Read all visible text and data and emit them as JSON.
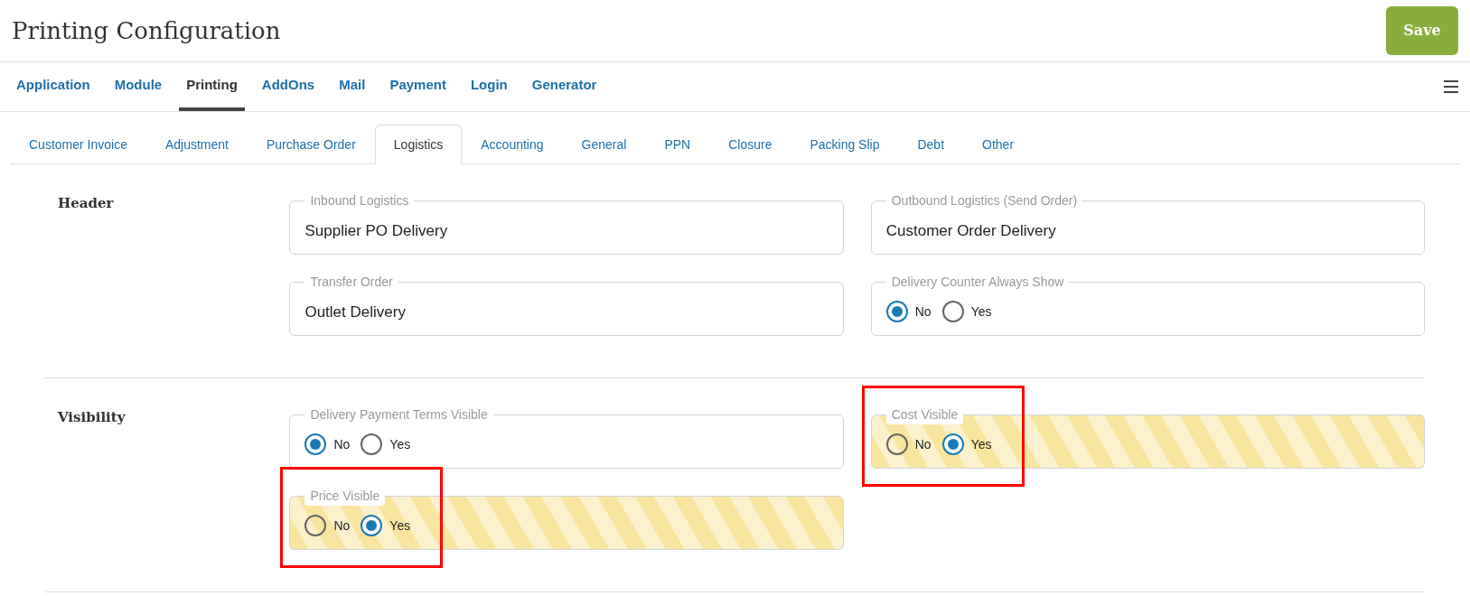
{
  "page": {
    "title": "Printing Configuration",
    "save_button": "Save"
  },
  "main_tabs": [
    {
      "label": "Application",
      "selected": false
    },
    {
      "label": "Module",
      "selected": false
    },
    {
      "label": "Printing",
      "selected": true
    },
    {
      "label": "AddOns",
      "selected": false
    },
    {
      "label": "Mail",
      "selected": false
    },
    {
      "label": "Payment",
      "selected": false
    },
    {
      "label": "Login",
      "selected": false
    },
    {
      "label": "Generator",
      "selected": false
    }
  ],
  "sub_tabs": [
    {
      "label": "Customer Invoice",
      "selected": false
    },
    {
      "label": "Adjustment",
      "selected": false
    },
    {
      "label": "Purchase Order",
      "selected": false
    },
    {
      "label": "Logistics",
      "selected": true
    },
    {
      "label": "Accounting",
      "selected": false
    },
    {
      "label": "General",
      "selected": false
    },
    {
      "label": "PPN",
      "selected": false
    },
    {
      "label": "Closure",
      "selected": false
    },
    {
      "label": "Packing Slip",
      "selected": false
    },
    {
      "label": "Debt",
      "selected": false
    },
    {
      "label": "Other",
      "selected": false
    }
  ],
  "sections": [
    {
      "title": "Header",
      "fields": [
        {
          "kind": "text",
          "label": "Inbound Logistics",
          "value": "Supplier PO Delivery",
          "highlighted": false,
          "annotated": false
        },
        {
          "kind": "text",
          "label": "Outbound Logistics (Send Order)",
          "value": "Customer Order Delivery",
          "highlighted": false,
          "annotated": false
        },
        {
          "kind": "text",
          "label": "Transfer Order",
          "value": "Outlet Delivery",
          "highlighted": false,
          "annotated": false
        },
        {
          "kind": "radio",
          "label": "Delivery Counter Always Show",
          "options": [
            {
              "label": "No",
              "selected": true
            },
            {
              "label": "Yes",
              "selected": false
            }
          ],
          "highlighted": false,
          "annotated": false
        }
      ]
    },
    {
      "title": "Visibility",
      "fields": [
        {
          "kind": "radio",
          "label": "Delivery Payment Terms Visible",
          "options": [
            {
              "label": "No",
              "selected": true
            },
            {
              "label": "Yes",
              "selected": false
            }
          ],
          "highlighted": false,
          "annotated": false
        },
        {
          "kind": "radio",
          "label": "Cost Visible",
          "options": [
            {
              "label": "No",
              "selected": false
            },
            {
              "label": "Yes",
              "selected": true
            }
          ],
          "highlighted": true,
          "annotated": true
        },
        {
          "kind": "radio",
          "label": "Price Visible",
          "options": [
            {
              "label": "No",
              "selected": false
            },
            {
              "label": "Yes",
              "selected": true
            }
          ],
          "highlighted": true,
          "annotated": true
        }
      ]
    }
  ]
}
